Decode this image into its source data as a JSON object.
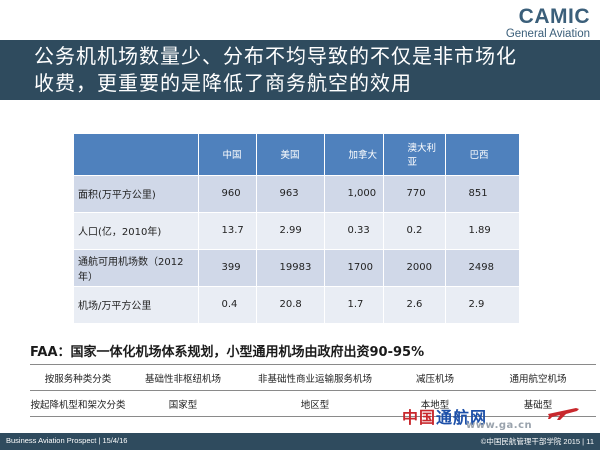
{
  "logo": {
    "brand": "CAMIC",
    "sub": "General Aviation"
  },
  "title": {
    "line1": "公务机机场数量少、分布不均导致的不仅是非市场化",
    "line2": "收费，更重要的是降低了商务航空的效用"
  },
  "table": {
    "columns": [
      "中国",
      "美国",
      "加拿大",
      "澳大利亚",
      "巴西"
    ],
    "rows": [
      {
        "label": "面积(万平方公里)",
        "values": [
          "960",
          "963",
          "1,000",
          "770",
          "851"
        ]
      },
      {
        "label": "人口(亿，2010年)",
        "values": [
          "13.7",
          "2.99",
          "0.33",
          "0.2",
          "1.89"
        ]
      },
      {
        "label": "通航可用机场数（2012年）",
        "values": [
          "399",
          "19983",
          "1700",
          "2000",
          "2498"
        ]
      },
      {
        "label": "机场/万平方公里",
        "values": [
          "0.4",
          "20.8",
          "1.7",
          "2.6",
          "2.9"
        ]
      }
    ]
  },
  "faa_note": "FAA：国家一体化机场体系规划，小型通用机场由政府出资90-95%",
  "classification": {
    "rows": [
      [
        "按服务种类分类",
        "基础性非枢纽机场",
        "非基础性商业运输服务机场",
        "减压机场",
        "通用航空机场"
      ],
      [
        "按起降机型和架次分类",
        "国家型",
        "地区型",
        "本地型",
        "基础型"
      ]
    ]
  },
  "watermark": {
    "part1": "中国",
    "part2": "通航网",
    "url": "www.ga.cn"
  },
  "footer": {
    "left": "Business Aviation Prospect  |  15/4/16",
    "right": "©中国民航管理干部学院 2015  |  11"
  }
}
